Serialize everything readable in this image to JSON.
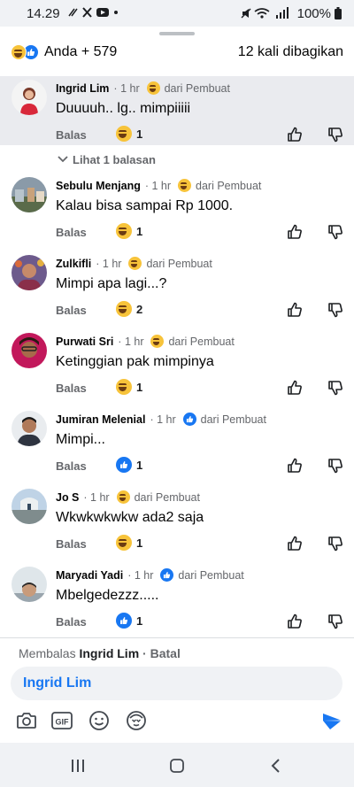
{
  "status_bar": {
    "time": "14.29",
    "icons": [
      "missed-call-icon",
      "x-icon",
      "youtube-icon",
      "dot-icon"
    ],
    "battery": "100%"
  },
  "header": {
    "reaction_count": "Anda + 579",
    "shares": "12 kali dibagikan"
  },
  "comments": [
    {
      "name": "Ingrid Lim",
      "time": "1 hr",
      "author_reaction": "haha",
      "author_label": "dari Pembuat",
      "text": "Duuuuh.. lg.. mimpiiiii",
      "reply_label": "Balas",
      "reaction": "haha",
      "reaction_count": "1",
      "highlighted": true,
      "view_replies": "Lihat 1 balasan"
    },
    {
      "name": "Sebulu Menjang",
      "time": "1 hr",
      "author_reaction": "haha",
      "author_label": "dari Pembuat",
      "text": "Kalau bisa sampai Rp 1000.",
      "reply_label": "Balas",
      "reaction": "haha",
      "reaction_count": "1"
    },
    {
      "name": "Zulkifli",
      "time": "1 hr",
      "author_reaction": "haha",
      "author_label": "dari Pembuat",
      "text": "Mimpi apa lagi...?",
      "reply_label": "Balas",
      "reaction": "haha",
      "reaction_count": "2"
    },
    {
      "name": "Purwati Sri",
      "time": "1 hr",
      "author_reaction": "haha",
      "author_label": "dari Pembuat",
      "text": "Ketinggian pak mimpinya",
      "reply_label": "Balas",
      "reaction": "haha",
      "reaction_count": "1"
    },
    {
      "name": "Jumiran Melenial",
      "time": "1 hr",
      "author_reaction": "like",
      "author_label": "dari Pembuat",
      "text": "Mimpi...",
      "reply_label": "Balas",
      "reaction": "like",
      "reaction_count": "1"
    },
    {
      "name": "Jo S",
      "time": "1 hr",
      "author_reaction": "haha",
      "author_label": "dari Pembuat",
      "text": "Wkwkwkwkw ada2 saja",
      "reply_label": "Balas",
      "reaction": "haha",
      "reaction_count": "1"
    },
    {
      "name": "Maryadi Yadi",
      "time": "1 hr",
      "author_reaction": "like",
      "author_label": "dari Pembuat",
      "text": "Mbelgedezzz.....",
      "reply_label": "Balas",
      "reaction": "like",
      "reaction_count": "1"
    }
  ],
  "composer": {
    "replying_prefix": "Membalas",
    "replying_to": "Ingrid Lim",
    "cancel": "· Batal",
    "input_value": "Ingrid Lim",
    "tools": [
      "camera-icon",
      "gif-icon",
      "emoji-icon",
      "avatar-sticker-icon",
      "send-icon"
    ]
  },
  "colors": {
    "accent": "#1877f2",
    "haha": "#f7c33a",
    "highlight": "#eaebef",
    "secondary_text": "#65676b"
  }
}
